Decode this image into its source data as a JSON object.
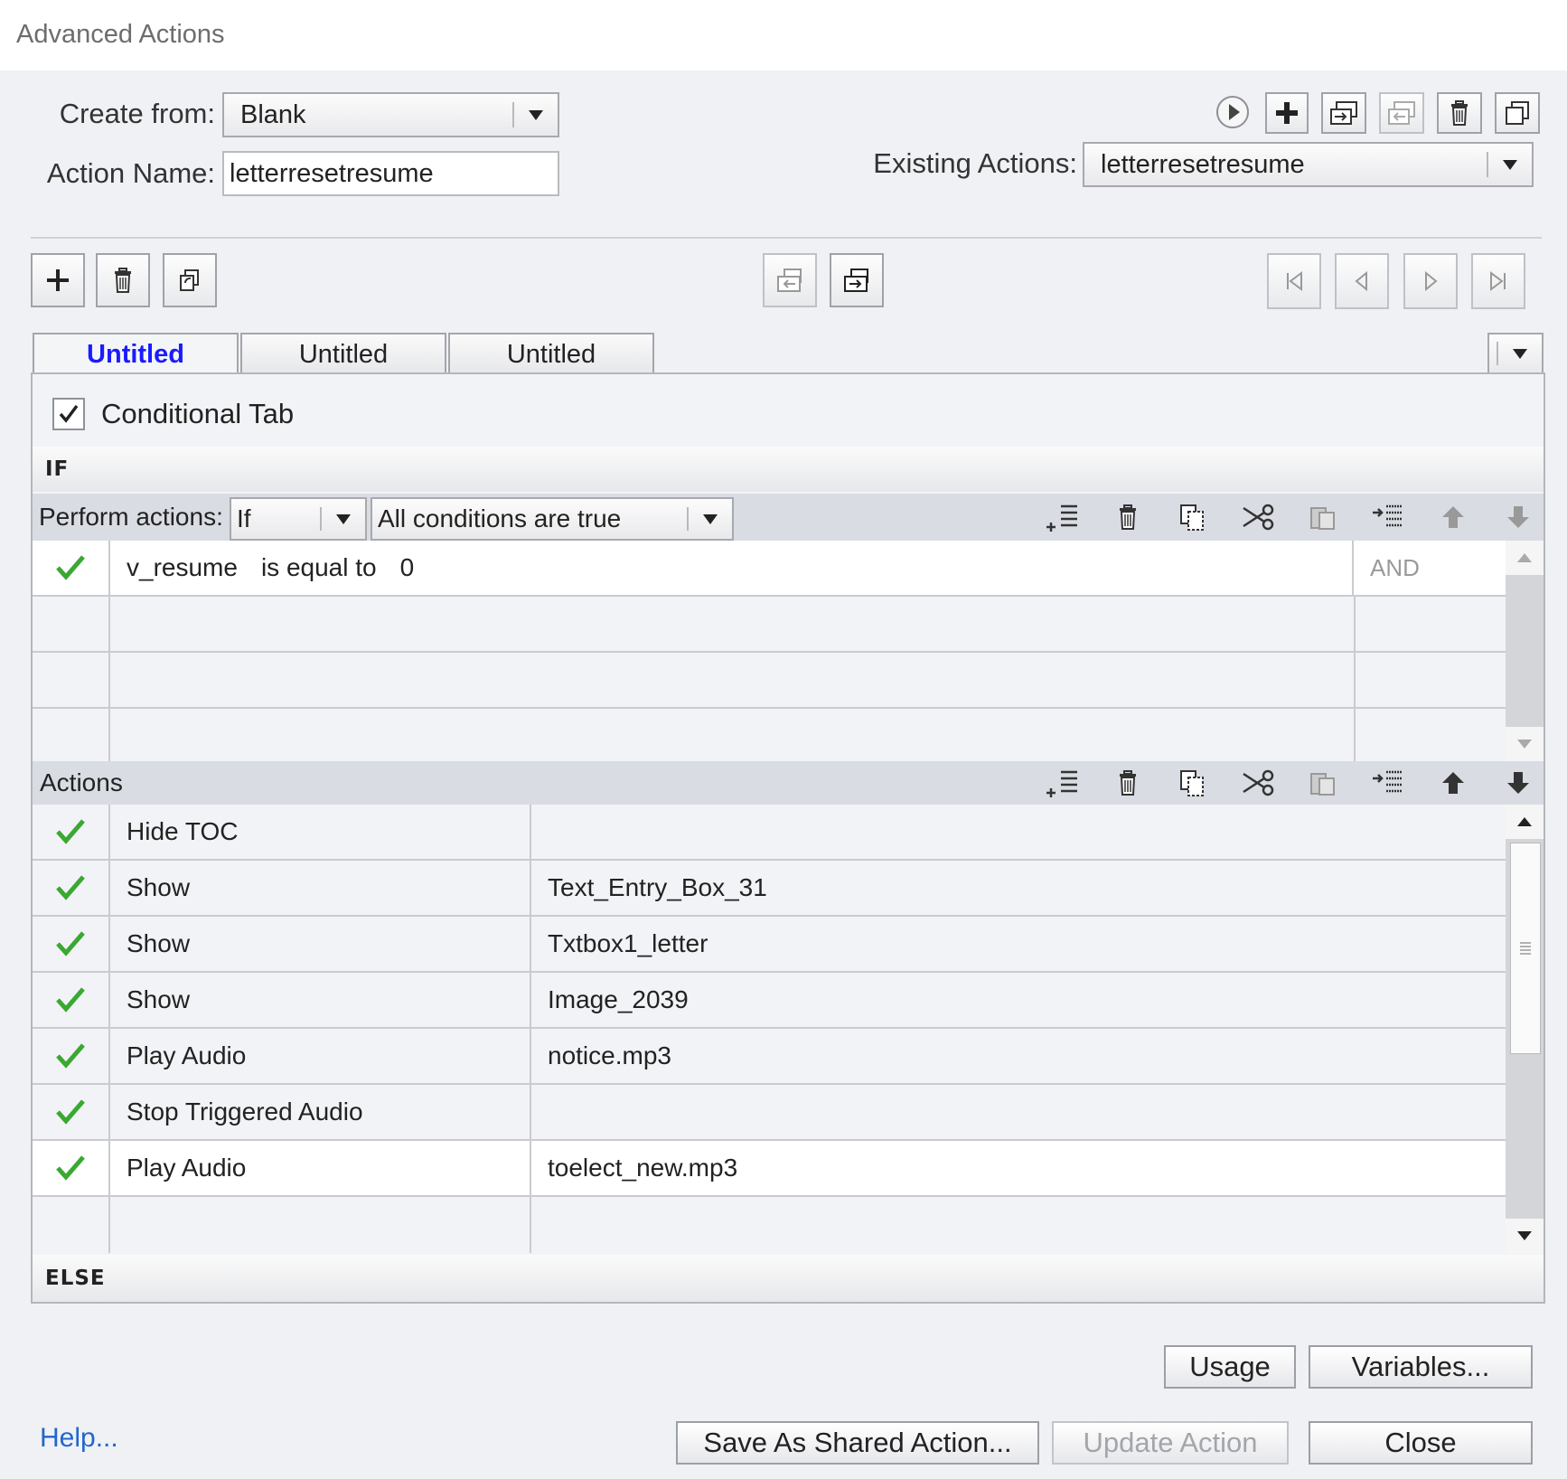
{
  "window": {
    "title": "Advanced Actions"
  },
  "header": {
    "create_from_label": "Create from:",
    "create_from_value": "Blank",
    "action_name_label": "Action Name:",
    "action_name_value": "letterresetresume",
    "existing_actions_label": "Existing Actions:",
    "existing_actions_value": "letterresetresume",
    "top_icons": [
      "preview-icon",
      "add-action-icon",
      "import-icon",
      "export-icon",
      "delete-icon",
      "duplicate-icon"
    ]
  },
  "decision_toolbar": {
    "left_icons": [
      "add-icon",
      "trash-icon",
      "clone-icon"
    ],
    "middle_icons": [
      "move-left-icon",
      "move-right-icon"
    ],
    "nav_icons": [
      "first-icon",
      "prev-icon",
      "next-icon",
      "last-icon"
    ]
  },
  "tabs": [
    {
      "label": "Untitled",
      "active": true
    },
    {
      "label": "Untitled",
      "active": false
    },
    {
      "label": "Untitled",
      "active": false
    }
  ],
  "conditional": {
    "label": "Conditional Tab",
    "checked": true
  },
  "if_section": {
    "header": "IF",
    "perform_label": "Perform actions:",
    "perform_value": "If",
    "conditions_value": "All conditions are true",
    "conditions": [
      {
        "variable": "v_resume",
        "operator": "is equal to",
        "value": "0",
        "join": "AND"
      }
    ]
  },
  "actions_section": {
    "header": "Actions",
    "rows": [
      {
        "action": "Hide TOC",
        "target": ""
      },
      {
        "action": "Show",
        "target": "Text_Entry_Box_31"
      },
      {
        "action": "Show",
        "target": "Txtbox1_letter"
      },
      {
        "action": "Show",
        "target": "Image_2039"
      },
      {
        "action": "Play Audio",
        "target": "notice.mp3"
      },
      {
        "action": "Stop Triggered Audio",
        "target": ""
      },
      {
        "action": "Play Audio",
        "target": "toelect_new.mp3"
      }
    ]
  },
  "else_section": {
    "header": "ELSE"
  },
  "footer": {
    "usage": "Usage",
    "variables": "Variables...",
    "help": "Help...",
    "save_shared": "Save As Shared Action...",
    "update_action": "Update Action",
    "close": "Close"
  },
  "colors": {
    "accent_tab": "#1b1bff",
    "check": "#3aa832",
    "help_link": "#2266cc"
  }
}
